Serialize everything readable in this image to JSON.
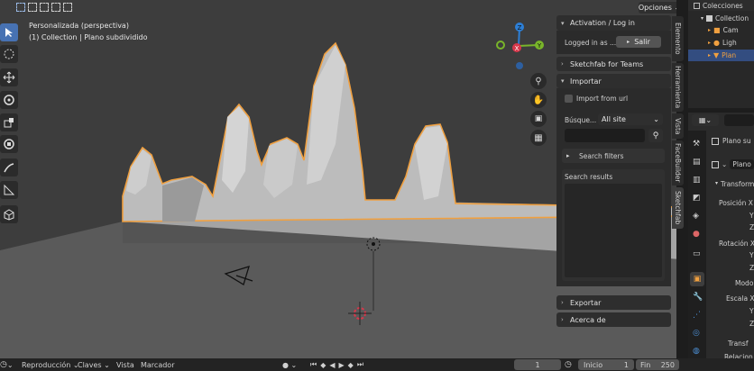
{
  "viewport": {
    "view_name": "Personalizada (perspectiva)",
    "collection_info": "(1) Collection | Plano subdividido",
    "options_label": "Opciones"
  },
  "gizmo": {
    "z": "Z",
    "y": "Y",
    "x": "X"
  },
  "npanel": {
    "activation": {
      "title": "Activation / Log in",
      "logged_in_as": "Logged in as ...",
      "logout_label": "Salir"
    },
    "teams_title": "Sketchfab for Teams",
    "importar": {
      "title": "Importar",
      "import_url_label": "Import from url",
      "search_label": "Búsque...",
      "search_scope": "All site",
      "search_placeholder": "",
      "search_filters_label": "Search filters",
      "search_results_label": "Search results"
    },
    "exportar_title": "Exportar",
    "acerca_title": "Acerca de"
  },
  "side_tabs": [
    "Elemento",
    "Herramienta",
    "Vista",
    "FaceBuilder",
    "Sketchfab"
  ],
  "outliner": {
    "root": "Colecciones",
    "collection": "Collection",
    "items": [
      "Cam",
      "Ligh",
      "Plan"
    ]
  },
  "properties": {
    "object_name": "Plano su",
    "object_field": "Plano",
    "transform_title": "Transform",
    "location_label": "Posición X",
    "rotation_label": "Rotación X",
    "mode_label": "Modo",
    "scale_label": "Escala X",
    "relations_label": "Relacion",
    "transform2_label": "Transf",
    "y_label": "Y",
    "z_label": "Z"
  },
  "timeline": {
    "playback": "Reproducción",
    "keys": "Claves",
    "view": "Vista",
    "marker": "Marcador",
    "current_frame": "1",
    "start_label": "Inicio",
    "start_value": "1",
    "end_label": "Fin",
    "end_value": "250"
  },
  "colors": {
    "accent": "#4772b3",
    "selection": "#f0a040",
    "x_axis": "#d6384b",
    "y_axis": "#79b52a",
    "z_axis": "#2d7fd6"
  }
}
